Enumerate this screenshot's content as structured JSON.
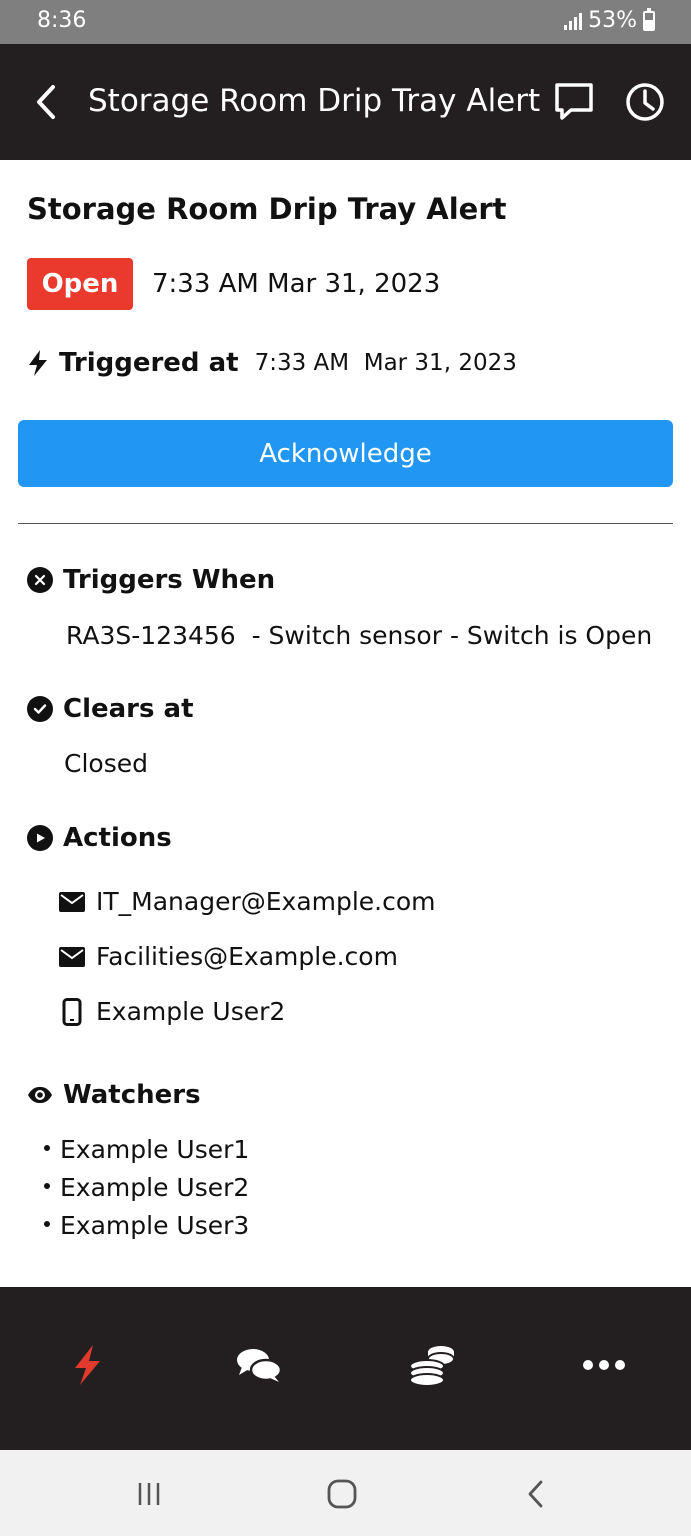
{
  "status_bar": {
    "time": "8:36",
    "battery": "53%",
    "battery_level": 0.53
  },
  "app_bar": {
    "title": "Storage Room Drip Tray Alert"
  },
  "alert": {
    "title": "Storage Room Drip Tray Alert",
    "status": "Open",
    "status_time": "7:33 AM Mar 31, 2023",
    "triggered_label": "Triggered at",
    "triggered_value": "7:33 AM  Mar 31, 2023"
  },
  "acknowledge_label": "Acknowledge",
  "triggers": {
    "heading": "Triggers When",
    "text": "RA3S-123456  - Switch sensor - Switch is Open"
  },
  "clears": {
    "heading": "Clears at",
    "text": "Closed"
  },
  "actions": {
    "heading": "Actions",
    "items": [
      {
        "type": "email",
        "icon": "envelope-icon",
        "label": "IT_Manager@Example.com"
      },
      {
        "type": "email",
        "icon": "envelope-icon",
        "label": "Facilities@Example.com"
      },
      {
        "type": "phone",
        "icon": "mobile-phone-icon",
        "label": "Example User2"
      }
    ]
  },
  "watchers": {
    "heading": "Watchers",
    "items": [
      "Example User1",
      "Example User2",
      "Example User3"
    ]
  },
  "colors": {
    "status_open": "#ea3a2d",
    "acknowledge": "#2196f3",
    "bar": "#231f20",
    "active_nav": "#e03a2c"
  }
}
